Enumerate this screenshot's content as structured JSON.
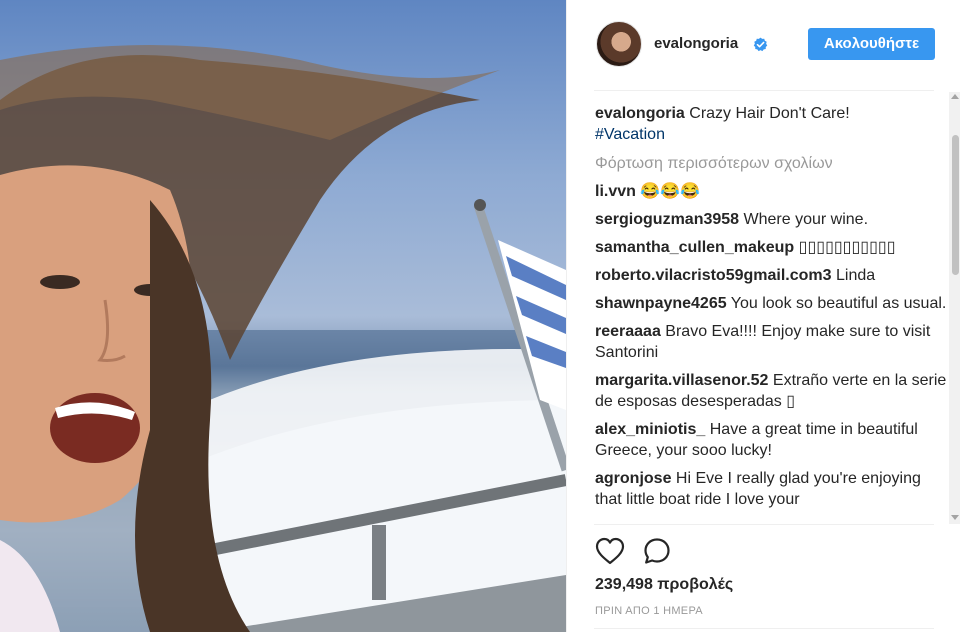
{
  "colors": {
    "follow_button_bg": "#3897f0",
    "hashtag": "#003569",
    "muted_text": "#999999",
    "verified_badge": "#3897f0"
  },
  "post": {
    "username": "evalongoria",
    "verified_icon": "verified-badge-icon",
    "follow_label": "Ακολουθήστε",
    "caption": {
      "username": "evalongoria",
      "text": "Crazy Hair Don't Care!",
      "hashtag": "#Vacation"
    },
    "load_more": "Φόρτωση περισσότερων σχολίων",
    "comments": [
      {
        "user": "li.vvn",
        "text": "😂😂😂"
      },
      {
        "user": "sergioguzman3958",
        "text": "Where your wine."
      },
      {
        "user": "samantha_cullen_makeup",
        "text": "▯▯▯▯▯▯▯▯▯▯▯"
      },
      {
        "user": "roberto.vilacristo59gmail.com3",
        "text": "Linda"
      },
      {
        "user": "shawnpayne4265",
        "text": "You look so beautiful as usual."
      },
      {
        "user": "reeraaaa",
        "text": "Bravo Eva!!!! Enjoy make sure to visit Santorini"
      },
      {
        "user": "margarita.villasenor.52",
        "text": "Extraño verte en la serie de esposas desesperadas ▯"
      },
      {
        "user": "alex_miniotis_",
        "text": "Have a great time in beautiful Greece, your sooo lucky!"
      },
      {
        "user": "agronjose",
        "text": "Hi Eve I really glad you're enjoying that little boat ride I love your"
      }
    ],
    "actions": {
      "like_icon": "heart-icon",
      "comment_icon": "comment-bubble-icon"
    },
    "views": "239,498 προβολές",
    "timestamp": "ΠΡΙΝ ΑΠΟ 1 ΗΜΕΡΑ"
  }
}
